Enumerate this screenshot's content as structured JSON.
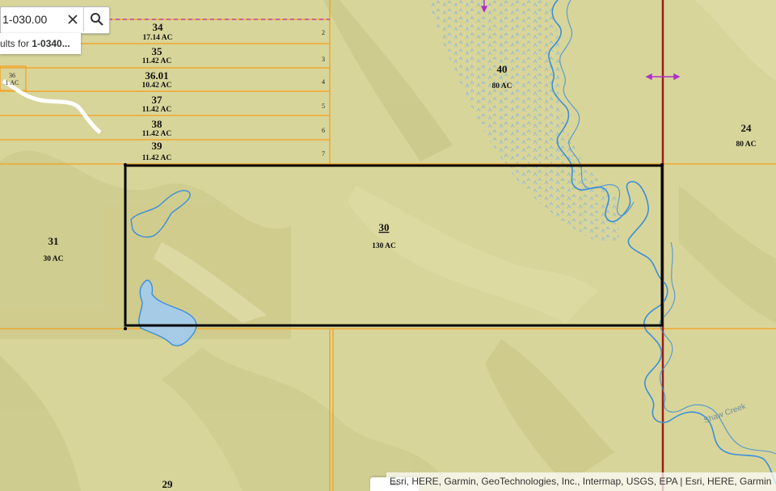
{
  "search": {
    "value": "1-030.00",
    "suggestion_prefix": "ults for ",
    "suggestion_query": "1-0340..."
  },
  "parcels": {
    "p34": {
      "num": "34",
      "ac": "17.14 AC",
      "idx": "2"
    },
    "p35": {
      "num": "35",
      "ac": "11.42 AC",
      "idx": "3"
    },
    "p3601": {
      "num": "36.01",
      "ac": "10.42 AC",
      "idx": "4"
    },
    "p37": {
      "num": "37",
      "ac": "11.42 AC",
      "idx": "5"
    },
    "p38": {
      "num": "38",
      "ac": "11.42 AC",
      "idx": "6"
    },
    "p39": {
      "num": "39",
      "ac": "11.42 AC",
      "idx": "7"
    },
    "p36": {
      "num": "36",
      "ac": "1 AC"
    },
    "p40": {
      "num": "40",
      "ac": "80 AC"
    },
    "p24": {
      "num": "24",
      "ac": "80 AC"
    },
    "p31": {
      "num": "31",
      "ac": "30 AC"
    },
    "p30": {
      "num": "30",
      "ac": "130 AC"
    },
    "p29": {
      "num": "29"
    }
  },
  "creek_label": "Shaw Creek",
  "attribution": "Esri, HERE, Garmin, GeoTechnologies, Inc., Intermap, USGS, EPA | Esri, HERE, Garmin",
  "colors": {
    "land": "#d8d59a",
    "parcel_line": "#f0a830",
    "selected_outline": "#000000",
    "water": "#3b8fd8",
    "water_fill": "#a6cbe6",
    "section_line": "#9b1c1c",
    "easement_line": "#b030c8"
  }
}
